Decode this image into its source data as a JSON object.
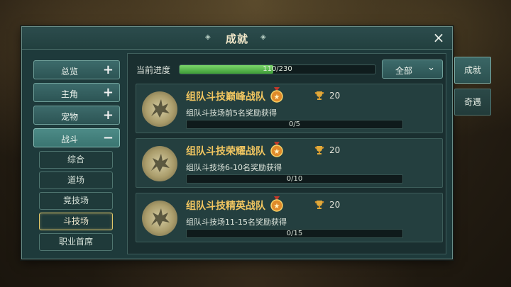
{
  "window": {
    "title": "成就",
    "close_icon": "×"
  },
  "sidebar": {
    "categories": [
      {
        "label": "总览",
        "sign": "+"
      },
      {
        "label": "主角",
        "sign": "+"
      },
      {
        "label": "宠物",
        "sign": "+"
      },
      {
        "label": "战斗",
        "sign": "−",
        "active": true
      }
    ],
    "subitems": [
      {
        "label": "综合"
      },
      {
        "label": "道场"
      },
      {
        "label": "竞技场"
      },
      {
        "label": "斗技场",
        "selected": true
      },
      {
        "label": "职业首席"
      }
    ]
  },
  "progress": {
    "label": "当前进度",
    "current": 110,
    "total": 230,
    "text": "110/230"
  },
  "filter": {
    "label": "全部",
    "icon": "chevron-down-icon"
  },
  "achievements": [
    {
      "name": "组队斗技巅峰战队",
      "points": "20",
      "desc": "组队斗技场前5名奖励获得",
      "progress": "0/5"
    },
    {
      "name": "组队斗技荣耀战队",
      "points": "20",
      "desc": "组队斗技场6-10名奖励获得",
      "progress": "0/10"
    },
    {
      "name": "组队斗技精英战队",
      "points": "20",
      "desc": "组队斗技场11-15名奖励获得",
      "progress": "0/15"
    }
  ],
  "side_tabs": [
    {
      "label": "成就",
      "active": true
    },
    {
      "label": "奇遇"
    }
  ],
  "colors": {
    "accent_gold": "#f0c560",
    "progress_green": "#5cbf4c",
    "panel_teal": "#1e3a3b"
  }
}
